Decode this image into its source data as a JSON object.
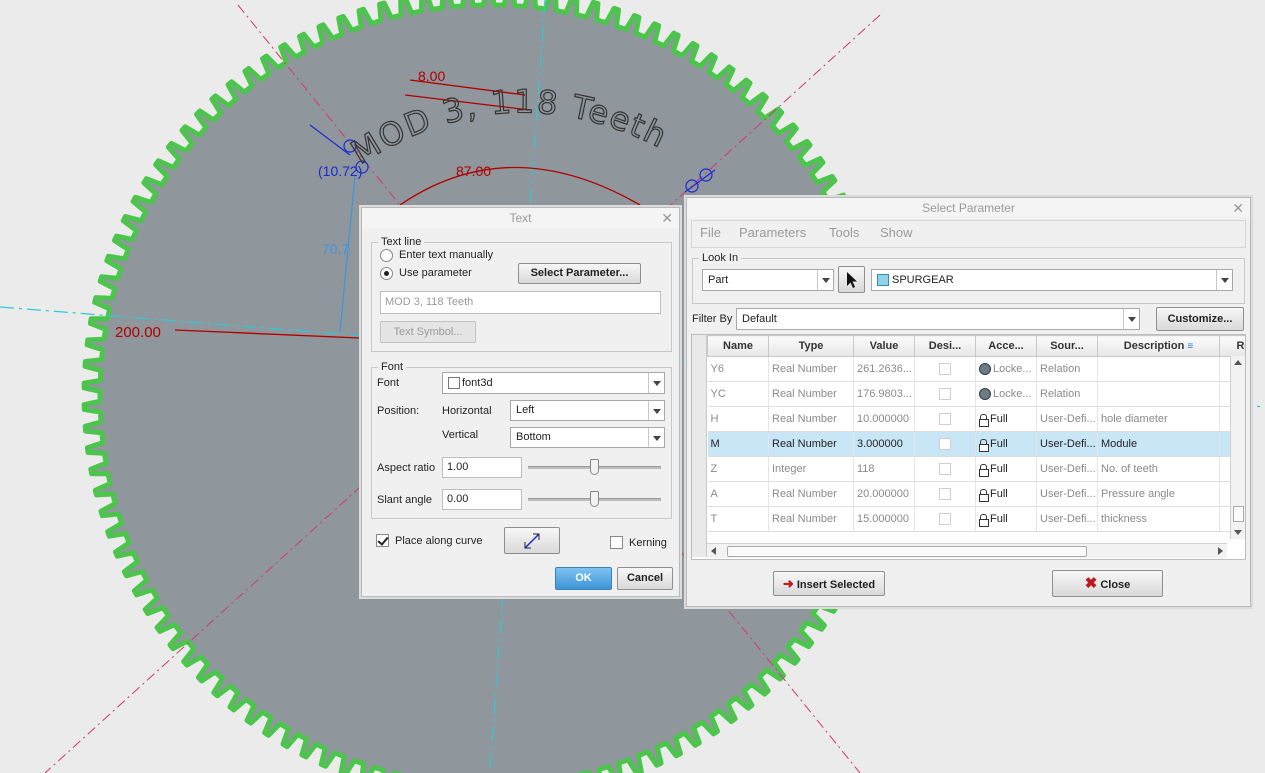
{
  "canvas": {
    "model_text": "MOD 3, 118 Teeth",
    "dimensions": {
      "d1": "8.00",
      "d2": "(10.72)",
      "d3": "87.00",
      "d4": "70.7",
      "d5": "200.00"
    }
  },
  "text_dialog": {
    "title": "Text",
    "text_line_group": "Text line",
    "option_manual": "Enter text manually",
    "option_parameter": "Use parameter",
    "select_parameter_button": "Select Parameter...",
    "text_value": "MOD 3, 118 Teeth",
    "text_symbol_button": "Text Symbol...",
    "font_group": "Font",
    "font_label": "Font",
    "font_value": "font3d",
    "position_label": "Position:",
    "horizontal_label": "Horizontal",
    "horizontal_value": "Left",
    "vertical_label": "Vertical",
    "vertical_value": "Bottom",
    "aspect_label": "Aspect ratio",
    "aspect_value": "1.00",
    "slant_label": "Slant angle",
    "slant_value": "0.00",
    "place_along_curve": "Place along curve",
    "kerning": "Kerning",
    "ok": "OK",
    "cancel": "Cancel"
  },
  "param_dialog": {
    "title": "Select Parameter",
    "menu": [
      "File",
      "Parameters",
      "Tools",
      "Show"
    ],
    "look_in_label": "Look In",
    "look_in_type": "Part",
    "look_in_model": "SPURGEAR",
    "filter_label": "Filter By",
    "filter_value": "Default",
    "customize": "Customize...",
    "columns": [
      "Name",
      "Type",
      "Value",
      "Desi...",
      "Acce...",
      "Sour...",
      "Description",
      "Re"
    ],
    "rows": [
      {
        "name": "Y6",
        "type": "Real Number",
        "value": "261.2636...",
        "access": "Locke...",
        "source": "Relation",
        "description": ""
      },
      {
        "name": "YC",
        "type": "Real Number",
        "value": "176.9803...",
        "access": "Locke...",
        "source": "Relation",
        "description": ""
      },
      {
        "name": "H",
        "type": "Real Number",
        "value": "10.000000",
        "access": "Full",
        "source": "User-Defi...",
        "description": "hole diameter"
      },
      {
        "name": "M",
        "type": "Real Number",
        "value": "3.000000",
        "access": "Full",
        "source": "User-Defi...",
        "description": "Module"
      },
      {
        "name": "Z",
        "type": "Integer",
        "value": "118",
        "access": "Full",
        "source": "User-Defi...",
        "description": "No. of teeth"
      },
      {
        "name": "A",
        "type": "Real Number",
        "value": "20.000000",
        "access": "Full",
        "source": "User-Defi...",
        "description": "Pressure angle"
      },
      {
        "name": "T",
        "type": "Real Number",
        "value": "15.000000",
        "access": "Full",
        "source": "User-Defi...",
        "description": "thickness"
      }
    ],
    "insert_selected": "Insert Selected",
    "close": "Close"
  },
  "colors": {
    "gear_fill": "#8f969c",
    "gear_teeth": "#4cc54c",
    "dimension": "#b00000",
    "centerline": "#2fc9d8",
    "reference": "#d03a6a",
    "selection": "#c9e6f7"
  }
}
